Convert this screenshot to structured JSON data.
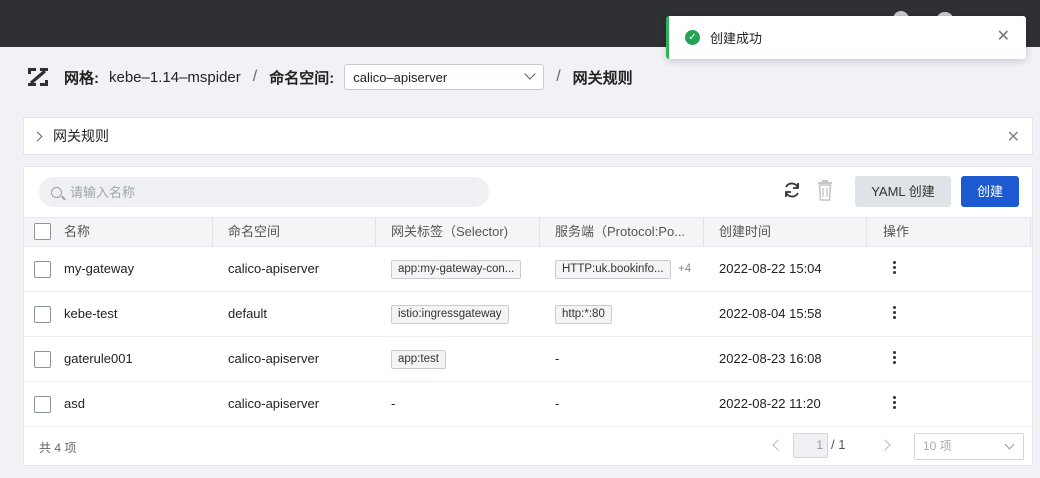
{
  "toast": {
    "message": "创建成功"
  },
  "breadcrumb": {
    "mesh_label": "网格:",
    "mesh_value": "kebe–1.14–mspider",
    "namespace_label": "命名空间:",
    "namespace_value": "calico–apiserver",
    "current": "网关规则"
  },
  "panel": {
    "title": "网关规则"
  },
  "toolbar": {
    "search_placeholder": "请输入名称",
    "yaml_button": "YAML 创建",
    "create_button": "创建"
  },
  "table": {
    "columns": [
      "名称",
      "命名空间",
      "网关标签（Selector)",
      "服务端（Protocol:Po...",
      "创建时间",
      "操作"
    ],
    "rows": [
      {
        "name": "my-gateway",
        "namespace": "calico-apiserver",
        "selector": "app:my-gateway-con...",
        "server": "HTTP:uk.bookinfo...",
        "server_more": "+4",
        "created": "2022-08-22 15:04"
      },
      {
        "name": "kebe-test",
        "namespace": "default",
        "selector": "istio:ingressgateway",
        "server": "http:*:80",
        "server_more": "",
        "created": "2022-08-04 15:58"
      },
      {
        "name": "gaterule001",
        "namespace": "calico-apiserver",
        "selector": "app:test",
        "server": "-",
        "server_more": "",
        "created": "2022-08-23 16:08"
      },
      {
        "name": "asd",
        "namespace": "calico-apiserver",
        "selector": "-",
        "server": "-",
        "server_more": "",
        "created": "2022-08-22 11:20"
      }
    ]
  },
  "pagination": {
    "total_text": "共 4 项",
    "current_page": "1",
    "total_pages": "/ 1",
    "page_size": "10 项"
  }
}
